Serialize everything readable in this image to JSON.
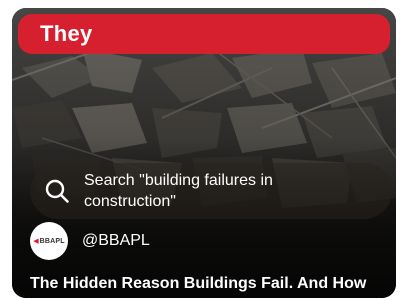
{
  "card": {
    "banner_title": "They",
    "banner_color": "#d7202f"
  },
  "search": {
    "icon": "search-icon",
    "query_text": "Search \"building failures in construction\""
  },
  "channel": {
    "avatar_label": "BBAPL",
    "handle": "@BBAPL"
  },
  "video": {
    "title": "The Hidden Reason Buildings Fail. And How"
  }
}
